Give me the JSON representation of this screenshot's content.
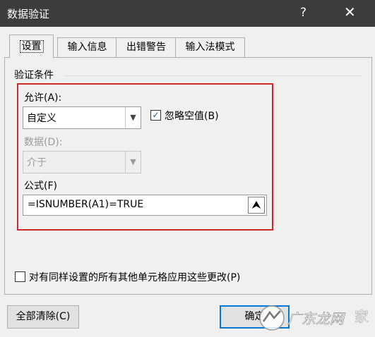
{
  "window": {
    "title": "数据验证",
    "help_icon": "?",
    "close_icon": "✕"
  },
  "tabs": [
    {
      "label": "设置",
      "active": true
    },
    {
      "label": "输入信息",
      "active": false
    },
    {
      "label": "出错警告",
      "active": false
    },
    {
      "label": "输入法模式",
      "active": false
    }
  ],
  "criteria": {
    "group_title": "验证条件",
    "allow_label": "允许(A):",
    "allow_value": "自定义",
    "ignore_blank_label": "忽略空值(B)",
    "ignore_blank_checked": true,
    "data_label": "数据(D):",
    "data_value": "介于",
    "formula_label": "公式(F)",
    "formula_value": "=ISNUMBER(A1)=TRUE"
  },
  "apply_all_label": "对有同样设置的所有其他单元格应用这些更改(P)",
  "buttons": {
    "clear_all": "全部清除(C)",
    "ok": "确定"
  },
  "watermark": {
    "text": "广东龙网",
    "suffix": "家"
  },
  "colors": {
    "titlebar": "#3c3c3c",
    "highlight": "#cc2a2a",
    "accent": "#0078d7"
  }
}
